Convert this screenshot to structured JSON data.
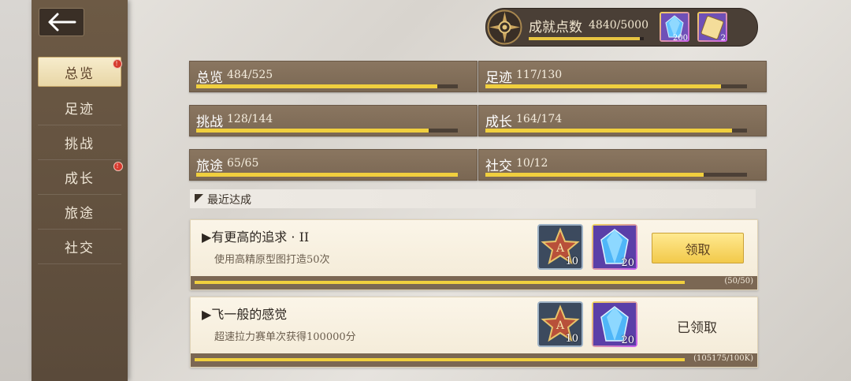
{
  "nav": {
    "items": [
      {
        "label": "总览",
        "active": true,
        "badge": "!"
      },
      {
        "label": "足迹",
        "active": false,
        "badge": ""
      },
      {
        "label": "挑战",
        "active": false,
        "badge": ""
      },
      {
        "label": "成长",
        "active": false,
        "badge": "!"
      },
      {
        "label": "旅途",
        "active": false,
        "badge": ""
      },
      {
        "label": "社交",
        "active": false,
        "badge": ""
      }
    ]
  },
  "header": {
    "points_label": "成就点数",
    "points_value": "4840/5000",
    "points_progress": 0.968,
    "rewards": [
      {
        "icon": "blue-crystal-icon",
        "count": "200"
      },
      {
        "icon": "ticket-icon",
        "count": "2"
      }
    ]
  },
  "stats": [
    {
      "name": "总览",
      "value": "484/525",
      "progress": 0.922
    },
    {
      "name": "足迹",
      "value": "117/130",
      "progress": 0.9
    },
    {
      "name": "挑战",
      "value": "128/144",
      "progress": 0.889
    },
    {
      "name": "成长",
      "value": "164/174",
      "progress": 0.943
    },
    {
      "name": "旅途",
      "value": "65/65",
      "progress": 1.0
    },
    {
      "name": "社交",
      "value": "10/12",
      "progress": 0.833
    }
  ],
  "recent": {
    "title": "最近达成",
    "cards": [
      {
        "title": "▶有更高的追求 · II",
        "desc": "使用高精原型图打造50次",
        "reward1": {
          "icon": "star-a-badge-icon",
          "count": "10"
        },
        "reward2": {
          "icon": "blue-crystal-icon",
          "count": "20"
        },
        "action": "领取",
        "claimed": false,
        "progress_text": "(50/50)",
        "progress": 1.0
      },
      {
        "title": "▶飞一般的感觉",
        "desc": "超速拉力赛单次获得100000分",
        "reward1": {
          "icon": "star-a-badge-icon",
          "count": "10"
        },
        "reward2": {
          "icon": "blue-crystal-icon",
          "count": "20"
        },
        "action": "已领取",
        "claimed": true,
        "progress_text": "(105175/100K)",
        "progress": 1.0
      }
    ]
  },
  "colors": {
    "accent_gold": "#f0cf3e",
    "sidebar_brown": "#5f4d3c",
    "card_bg": "#f8f1e2",
    "badge_red": "#d63a2e"
  }
}
